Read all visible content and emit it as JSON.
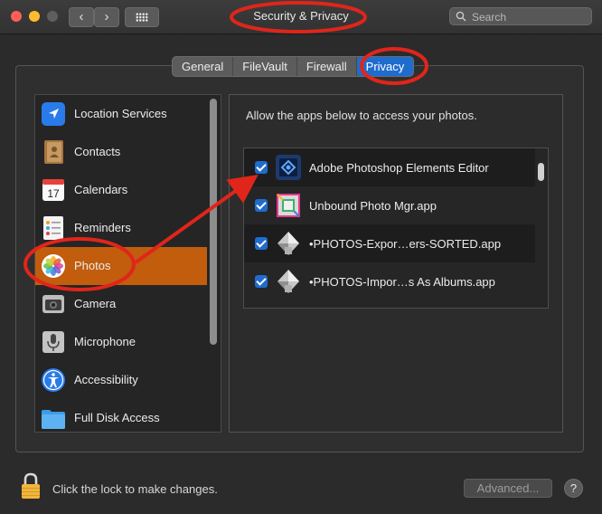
{
  "window": {
    "title": "Security & Privacy",
    "nav_back": "‹",
    "nav_forward": "›"
  },
  "search": {
    "placeholder": "Search",
    "value": ""
  },
  "tabs": [
    {
      "label": "General",
      "active": false
    },
    {
      "label": "FileVault",
      "active": false
    },
    {
      "label": "Firewall",
      "active": false
    },
    {
      "label": "Privacy",
      "active": true
    }
  ],
  "sidebar": {
    "items": [
      {
        "label": "Location Services",
        "icon": "location-arrow-icon"
      },
      {
        "label": "Contacts",
        "icon": "contacts-book-icon"
      },
      {
        "label": "Calendars",
        "icon": "calendar-icon",
        "icon_text": "17"
      },
      {
        "label": "Reminders",
        "icon": "reminders-list-icon"
      },
      {
        "label": "Photos",
        "icon": "photos-flower-icon",
        "selected": true
      },
      {
        "label": "Camera",
        "icon": "camera-icon"
      },
      {
        "label": "Microphone",
        "icon": "microphone-icon"
      },
      {
        "label": "Accessibility",
        "icon": "accessibility-icon"
      },
      {
        "label": "Full Disk Access",
        "icon": "folder-icon"
      }
    ]
  },
  "panel": {
    "description": "Allow the apps below to access your photos.",
    "apps": [
      {
        "label": "Adobe Photoshop Elements Editor",
        "checked": true,
        "icon": "photoshop-elements-icon"
      },
      {
        "label": "Unbound Photo Mgr.app",
        "checked": true,
        "icon": "unbound-cube-icon"
      },
      {
        "label": "•PHOTOS-Expor…ers-SORTED.app",
        "checked": true,
        "icon": "automator-script-icon"
      },
      {
        "label": "•PHOTOS-Impor…s As Albums.app",
        "checked": true,
        "icon": "automator-script-icon"
      }
    ]
  },
  "footer": {
    "lock_text": "Click the lock to make changes.",
    "advanced_label": "Advanced...",
    "help_label": "?"
  },
  "colors": {
    "accent": "#1f6ccf",
    "selection": "#c15d0c",
    "annotation": "#e0251b"
  }
}
